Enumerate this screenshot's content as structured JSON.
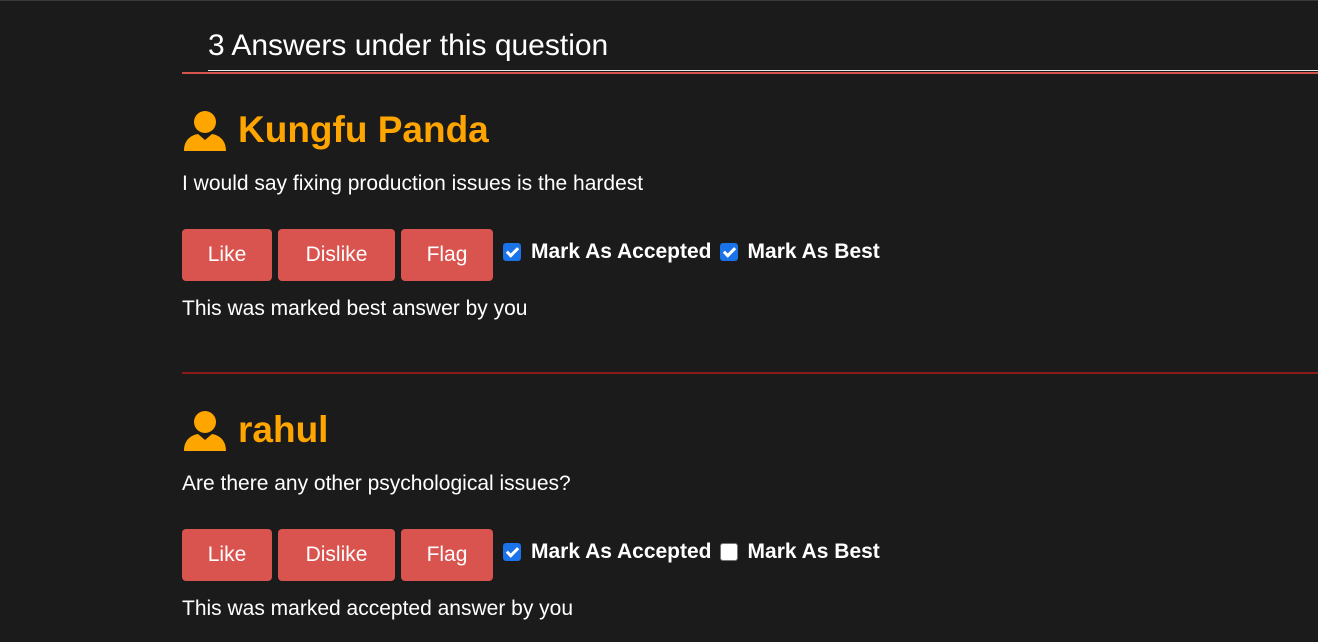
{
  "heading": "3 Answers under this question",
  "colors": {
    "accent": "#d9534f",
    "author": "#ffa500",
    "checkbox": "#1a73e8",
    "background": "#1b1b1b"
  },
  "answers": [
    {
      "author": "Kungfu Panda",
      "author_icon": "user-icon",
      "text": "I would say fixing production issues is the hardest",
      "buttons": {
        "like": "Like",
        "dislike": "Dislike",
        "flag": "Flag"
      },
      "accepted": {
        "label": "Mark As Accepted",
        "checked": true
      },
      "best": {
        "label": "Mark As Best",
        "checked": true
      },
      "status": "This was marked best answer by you"
    },
    {
      "author": "rahul",
      "author_icon": "user-icon",
      "text": "Are there any other psychological issues?",
      "buttons": {
        "like": "Like",
        "dislike": "Dislike",
        "flag": "Flag"
      },
      "accepted": {
        "label": "Mark As Accepted",
        "checked": true
      },
      "best": {
        "label": "Mark As Best",
        "checked": false
      },
      "status": "This was marked accepted answer by you"
    }
  ]
}
